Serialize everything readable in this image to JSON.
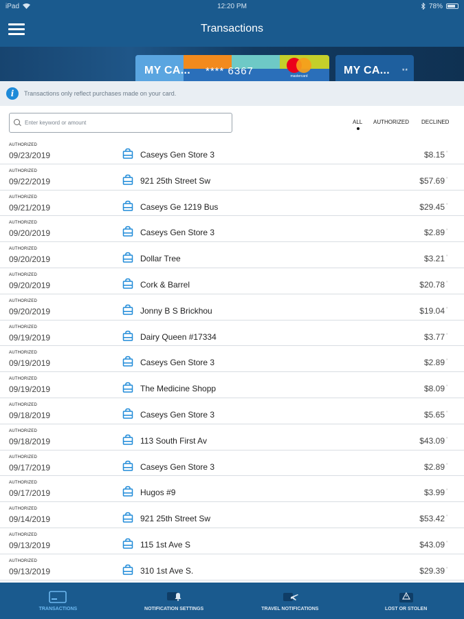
{
  "status_bar": {
    "device": "iPad",
    "time": "12:20 PM",
    "battery": "78%"
  },
  "header": {
    "title": "Transactions"
  },
  "cards": [
    {
      "name": "MY CA...",
      "number": "**** 6367",
      "brand": "mastercard"
    },
    {
      "name": "MY CA...",
      "number": "**"
    }
  ],
  "info_banner": {
    "text": "Transactions only reflect purchases made on your card."
  },
  "search": {
    "placeholder": "Enter keyword or amount"
  },
  "filters": {
    "all": "ALL",
    "authorized": "AUTHORIZED",
    "declined": "DECLINED",
    "active": "ALL"
  },
  "transactions": [
    {
      "status": "AUTHORIZED",
      "date": "09/23/2019",
      "merchant": "Caseys Gen Store 3",
      "amount": "$8.15"
    },
    {
      "status": "AUTHORIZED",
      "date": "09/22/2019",
      "merchant": "921 25th Street Sw",
      "amount": "$57.69"
    },
    {
      "status": "AUTHORIZED",
      "date": "09/21/2019",
      "merchant": "Caseys Ge 1219 Bus",
      "amount": "$29.45"
    },
    {
      "status": "AUTHORIZED",
      "date": "09/20/2019",
      "merchant": "Caseys Gen Store 3",
      "amount": "$2.89"
    },
    {
      "status": "AUTHORIZED",
      "date": "09/20/2019",
      "merchant": "Dollar Tree",
      "amount": "$3.21"
    },
    {
      "status": "AUTHORIZED",
      "date": "09/20/2019",
      "merchant": "Cork & Barrel",
      "amount": "$20.78"
    },
    {
      "status": "AUTHORIZED",
      "date": "09/20/2019",
      "merchant": "Jonny B S Brickhou",
      "amount": "$19.04"
    },
    {
      "status": "AUTHORIZED",
      "date": "09/19/2019",
      "merchant": "Dairy Queen #17334",
      "amount": "$3.77"
    },
    {
      "status": "AUTHORIZED",
      "date": "09/19/2019",
      "merchant": "Caseys Gen Store 3",
      "amount": "$2.89"
    },
    {
      "status": "AUTHORIZED",
      "date": "09/19/2019",
      "merchant": "The Medicine Shopp",
      "amount": "$8.09"
    },
    {
      "status": "AUTHORIZED",
      "date": "09/18/2019",
      "merchant": "Caseys Gen Store 3",
      "amount": "$5.65"
    },
    {
      "status": "AUTHORIZED",
      "date": "09/18/2019",
      "merchant": "113 South First Av",
      "amount": "$43.09"
    },
    {
      "status": "AUTHORIZED",
      "date": "09/17/2019",
      "merchant": "Caseys Gen Store 3",
      "amount": "$2.89"
    },
    {
      "status": "AUTHORIZED",
      "date": "09/17/2019",
      "merchant": "Hugos #9",
      "amount": "$3.99"
    },
    {
      "status": "AUTHORIZED",
      "date": "09/14/2019",
      "merchant": "921 25th Street Sw",
      "amount": "$53.42"
    },
    {
      "status": "AUTHORIZED",
      "date": "09/13/2019",
      "merchant": "115 1st Ave S",
      "amount": "$43.09"
    },
    {
      "status": "AUTHORIZED",
      "date": "09/13/2019",
      "merchant": "310 1st Ave S.",
      "amount": "$29.39"
    }
  ],
  "tabs": [
    {
      "label": "TRANSACTIONS",
      "icon": "card-icon",
      "active": true
    },
    {
      "label": "NOTIFICATION SETTINGS",
      "icon": "bell-icon",
      "active": false
    },
    {
      "label": "TRAVEL NOTIFICATIONS",
      "icon": "airplane-icon",
      "active": false
    },
    {
      "label": "LOST OR STOLEN",
      "icon": "warning-card-icon",
      "active": false
    }
  ],
  "colors": {
    "header_bg": "#1a5a8e",
    "accent": "#1e8ad8",
    "tab_active": "#6cb8f0"
  }
}
